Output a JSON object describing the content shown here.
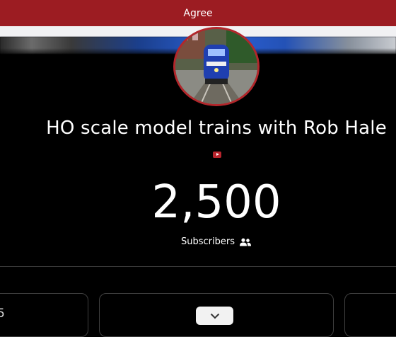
{
  "consent_bar": {
    "agree_label": "Agree"
  },
  "channel": {
    "title": "HO scale model trains with Rob Hale",
    "subscriber_count": "2,500",
    "subscribers_label": "Subscribers"
  },
  "cards": {
    "left_card_text": "5"
  },
  "icons": {
    "platform": "youtube-icon",
    "subscribers": "users-icon",
    "expand": "chevron-down-icon"
  },
  "colors": {
    "accent": "#9c1c22",
    "background": "#000000",
    "avatar_border": "#b3262b"
  }
}
